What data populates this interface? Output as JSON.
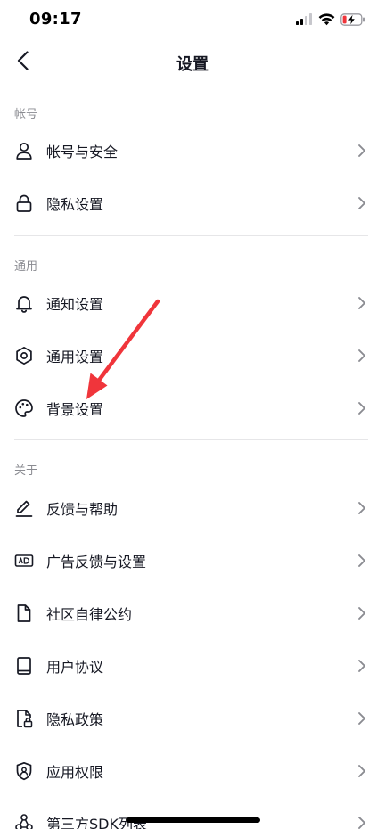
{
  "status": {
    "time": "09:17"
  },
  "nav": {
    "title": "设置"
  },
  "sections": [
    {
      "header": "帐号",
      "items": [
        {
          "label": "帐号与安全",
          "icon": "person-icon"
        },
        {
          "label": "隐私设置",
          "icon": "lock-icon"
        }
      ]
    },
    {
      "header": "通用",
      "items": [
        {
          "label": "通知设置",
          "icon": "bell-icon"
        },
        {
          "label": "通用设置",
          "icon": "gear-icon"
        },
        {
          "label": "背景设置",
          "icon": "palette-icon"
        }
      ]
    },
    {
      "header": "关于",
      "items": [
        {
          "label": "反馈与帮助",
          "icon": "pencil-icon"
        },
        {
          "label": "广告反馈与设置",
          "icon": "ad-icon"
        },
        {
          "label": "社区自律公约",
          "icon": "document-icon"
        },
        {
          "label": "用户协议",
          "icon": "book-icon"
        },
        {
          "label": "隐私政策",
          "icon": "privacy-doc-icon"
        },
        {
          "label": "应用权限",
          "icon": "shield-icon"
        },
        {
          "label": "第三方SDK列表",
          "icon": "share-nodes-icon"
        }
      ]
    }
  ],
  "colors": {
    "annotation_arrow": "#f0353b",
    "text_primary": "#161823",
    "text_secondary": "#8a8b91",
    "divider": "#e6e6e8",
    "battery_charging": "#f0353b"
  }
}
